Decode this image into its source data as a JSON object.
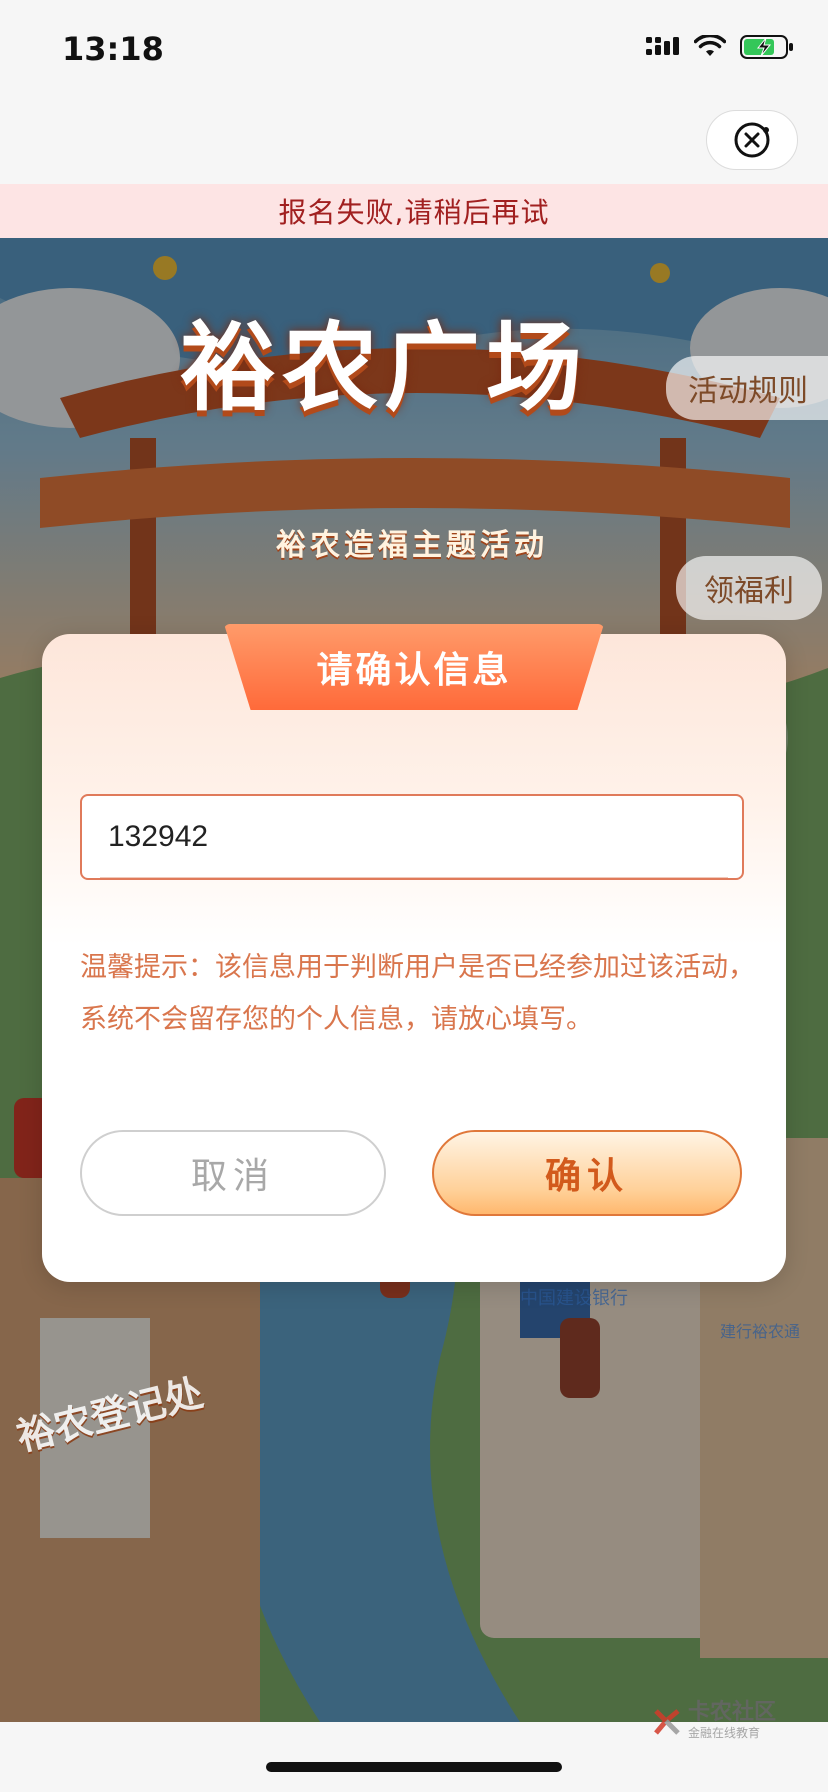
{
  "status_bar": {
    "time": "13:18"
  },
  "toast": {
    "message": "报名失败,请稍后再试"
  },
  "hero": {
    "title": "裕农广场",
    "subtitle": "裕农造福主题活动",
    "rules_label": "活动规则",
    "benefit_label": "领福利",
    "registry_sign": "裕农登记处",
    "bank_sign": "中国建设银行",
    "bank_sign2": "建行裕农通"
  },
  "modal": {
    "title": "请确认信息",
    "input_value": "132942",
    "tip": "温馨提示：该信息用于判断用户是否已经参加过该活动，系统不会留存您的个人信息，请放心填写。",
    "cancel_label": "取消",
    "confirm_label": "确认"
  },
  "watermark": {
    "line1": "卡农社区",
    "line2": "金融在线教育"
  },
  "colors": {
    "accent": "#ff6a3a",
    "toast_text": "#a12020",
    "tip_text": "#d9764d"
  }
}
